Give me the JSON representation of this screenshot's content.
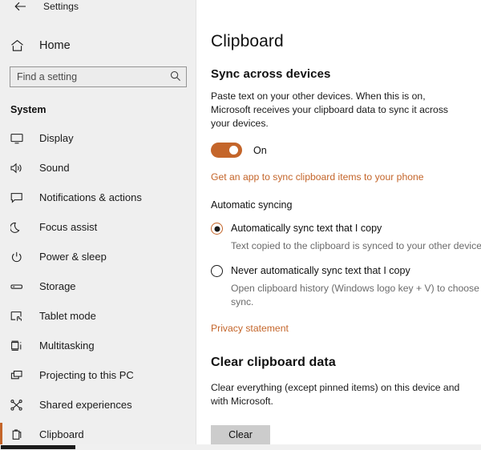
{
  "window": {
    "back_icon": "back-arrow-icon",
    "title": "Settings"
  },
  "sidebar": {
    "home": {
      "label": "Home",
      "icon": "home-icon"
    },
    "search": {
      "placeholder": "Find a setting",
      "value": "",
      "icon": "search-icon"
    },
    "group_title": "System",
    "items": [
      {
        "label": "Display",
        "icon": "monitor-icon",
        "selected": false
      },
      {
        "label": "Sound",
        "icon": "speaker-icon",
        "selected": false
      },
      {
        "label": "Notifications & actions",
        "icon": "notification-icon",
        "selected": false
      },
      {
        "label": "Focus assist",
        "icon": "moon-icon",
        "selected": false
      },
      {
        "label": "Power & sleep",
        "icon": "power-icon",
        "selected": false
      },
      {
        "label": "Storage",
        "icon": "storage-icon",
        "selected": false
      },
      {
        "label": "Tablet mode",
        "icon": "tablet-icon",
        "selected": false
      },
      {
        "label": "Multitasking",
        "icon": "multitasking-icon",
        "selected": false
      },
      {
        "label": "Projecting to this PC",
        "icon": "projecting-icon",
        "selected": false
      },
      {
        "label": "Shared experiences",
        "icon": "share-icon",
        "selected": false
      },
      {
        "label": "Clipboard",
        "icon": "clipboard-icon",
        "selected": true
      }
    ]
  },
  "main": {
    "page_title": "Clipboard",
    "sync_section": {
      "heading": "Sync across devices",
      "description": "Paste text on your other devices. When this is on, Microsoft receives your clipboard data to sync it across your devices.",
      "toggle_state": "On",
      "toggle_on": true,
      "app_link": "Get an app to sync clipboard items to your phone"
    },
    "automatic_syncing": {
      "heading": "Automatic syncing",
      "options": [
        {
          "label": "Automatically sync text that I copy",
          "description": "Text copied to the clipboard is synced to your other devices.",
          "selected": true
        },
        {
          "label": "Never automatically sync text that I copy",
          "description": "Open clipboard history (Windows logo key + V) to choose text to sync.",
          "selected": false
        }
      ],
      "privacy_link": "Privacy statement"
    },
    "clear_section": {
      "heading": "Clear clipboard data",
      "description": "Clear everything (except pinned items) on this device and with Microsoft.",
      "button_label": "Clear"
    }
  },
  "colors": {
    "accent": "#c4652a",
    "sidebar_bg": "#efefef",
    "main_bg": "#ffffff",
    "text": "#101010",
    "muted_text": "#6b6b6b"
  }
}
